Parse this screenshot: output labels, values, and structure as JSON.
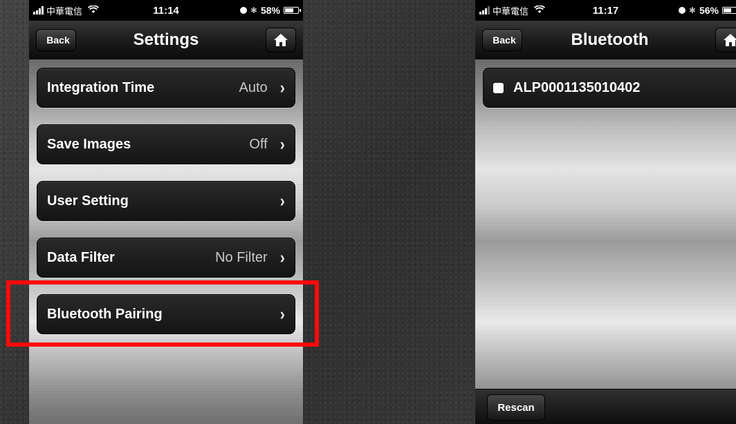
{
  "left_screen": {
    "status_bar": {
      "carrier": "中華電信",
      "time": "11:14",
      "battery": "58%",
      "battery_level": 0.58
    },
    "nav": {
      "back_label": "Back",
      "title": "Settings"
    },
    "rows": [
      {
        "label": "Integration Time",
        "value": "Auto"
      },
      {
        "label": "Save Images",
        "value": "Off"
      },
      {
        "label": "User Setting",
        "value": ""
      },
      {
        "label": "Data Filter",
        "value": "No Filter"
      },
      {
        "label": "Bluetooth Pairing",
        "value": ""
      }
    ],
    "highlight_color": "#ff0a0a"
  },
  "right_screen": {
    "status_bar": {
      "carrier": "中華電信",
      "time": "11:17",
      "battery": "56%",
      "battery_level": 0.56
    },
    "nav": {
      "back_label": "Back",
      "title": "Bluetooth"
    },
    "devices": [
      {
        "label": "ALP0001135010402"
      }
    ],
    "toolbar": {
      "rescan_label": "Rescan"
    }
  },
  "icons": {
    "home": "home-icon",
    "chevron": "chevron-right-icon",
    "wifi": "wifi-icon",
    "bluetooth": "bluetooth-icon",
    "lock": "orientation-lock-icon"
  }
}
